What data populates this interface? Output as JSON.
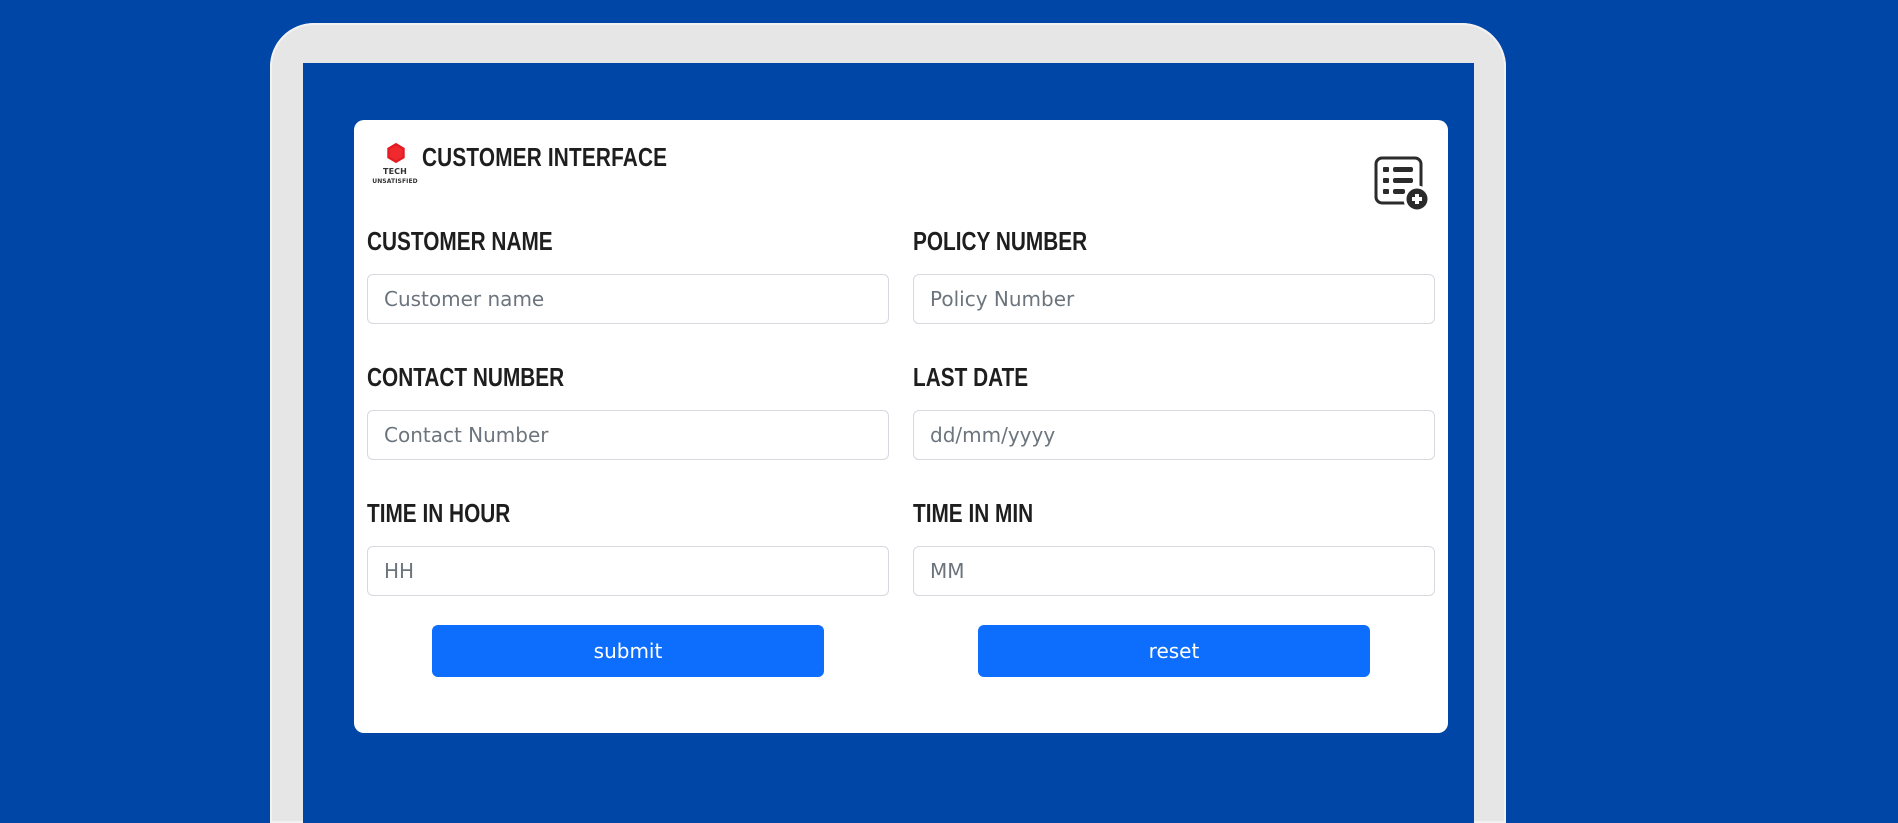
{
  "theme": {
    "background": "#0046a6",
    "device_frame": "#e6e6e6",
    "card": "#ffffff",
    "text": "#1e1e1e",
    "primary": "#0d6efd",
    "logo_red": "#e31b23"
  },
  "header": {
    "logo": {
      "brand": "TECH",
      "tagline": "UNSATISFIED",
      "icon": "red-hexagon-icon"
    },
    "title": "CUSTOMER INTERFACE",
    "action_icon": "list-add-icon"
  },
  "form": {
    "fields": [
      {
        "label": "CUSTOMER NAME",
        "placeholder": "Customer name",
        "value": ""
      },
      {
        "label": "POLICY NUMBER",
        "placeholder": "Policy Number",
        "value": ""
      },
      {
        "label": "CONTACT NUMBER",
        "placeholder": "Contact Number",
        "value": ""
      },
      {
        "label": "LAST DATE",
        "placeholder": "dd/mm/yyyy",
        "value": ""
      },
      {
        "label": "TIME IN HOUR",
        "placeholder": "HH",
        "value": ""
      },
      {
        "label": "TIME IN MIN",
        "placeholder": "MM",
        "value": ""
      }
    ],
    "buttons": {
      "submit": "submit",
      "reset": "reset"
    }
  }
}
